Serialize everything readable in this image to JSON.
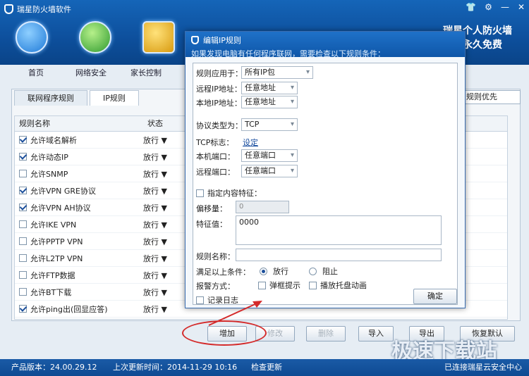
{
  "app": {
    "title": "瑞星防火墙软件",
    "brand_line1": "瑞星个人防火墙",
    "brand_line2": "永久免费"
  },
  "window_controls": [
    "shirt-icon",
    "gear-icon",
    "minimize-icon",
    "close-icon"
  ],
  "nav": [
    "首页",
    "网络安全",
    "家长控制"
  ],
  "tabs": [
    "联网程序规则",
    "IP规则"
  ],
  "sort_select": "规则优先",
  "grid": {
    "headers": {
      "name": "规则名称",
      "state": "状态"
    },
    "rows": [
      {
        "name": "允许域名解析",
        "checked": true,
        "state": "放行 ▼"
      },
      {
        "name": "允许动态IP",
        "checked": true,
        "state": "放行 ▼"
      },
      {
        "name": "允许SNMP",
        "checked": false,
        "state": "放行 ▼"
      },
      {
        "name": "允许VPN  GRE协议",
        "checked": true,
        "state": "放行 ▼"
      },
      {
        "name": "允许VPN  AH协议",
        "checked": true,
        "state": "放行 ▼"
      },
      {
        "name": "允许IKE VPN",
        "checked": false,
        "state": "放行 ▼"
      },
      {
        "name": "允许PPTP VPN",
        "checked": false,
        "state": "放行 ▼"
      },
      {
        "name": "允许L2TP VPN",
        "checked": false,
        "state": "放行 ▼"
      },
      {
        "name": "允许FTP数据",
        "checked": false,
        "state": "放行 ▼"
      },
      {
        "name": "允许BT下载",
        "checked": false,
        "state": "放行 ▼"
      },
      {
        "name": "允许ping出(回显应答)",
        "checked": true,
        "state": "放行 ▼"
      }
    ]
  },
  "buttons": {
    "add": "增加",
    "modify": "修改",
    "delete": "删除",
    "import": "导入",
    "export": "导出",
    "restore": "恢复默认"
  },
  "status": {
    "version": "产品版本：24.00.29.12",
    "update": "上次更新时间：2014-11-29 10:16",
    "check": "检查更新",
    "cloud": "已连接瑞星云安全中心"
  },
  "watermark": "极速下载站",
  "dialog": {
    "title": "编辑IP规则",
    "subtitle": "如果发现电脑有任何程序联网，需要检查以下规则条件：",
    "apply_label": "规则应用于：",
    "apply_value": "所有IP包",
    "remote_ip_label": "远程IP地址：",
    "remote_ip_value": "任意地址",
    "local_ip_label": "本地IP地址：",
    "local_ip_value": "任意地址",
    "protocol_label": "协议类型为：",
    "protocol_value": "TCP",
    "tcp_flag_label": "TCP标志：",
    "tcp_flag_link": "设定",
    "local_port_label": "本机端口：",
    "local_port_value": "任意端口",
    "remote_port_label": "远程端口：",
    "remote_port_value": "任意端口",
    "feature_check_label": "指定内容特征：",
    "offset_label": "偏移量：",
    "offset_value": "0",
    "feature_label": "特征值：",
    "feature_value": "0000",
    "rule_name_label": "规则名称：",
    "rule_name_value": "",
    "condition_label": "满足以上条件：",
    "allow_label": "放行",
    "block_label": "阻止",
    "alert_label": "报警方式：",
    "popup_label": "弹框提示",
    "tray_label": "播放托盘动画",
    "log_label": "记录日志",
    "ok_label": "确定"
  }
}
